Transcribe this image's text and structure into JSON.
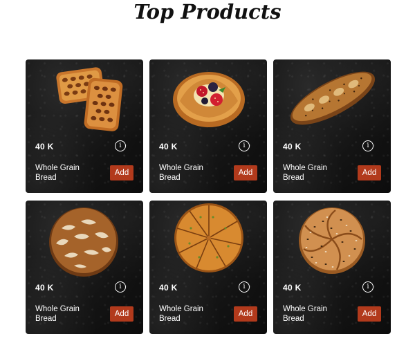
{
  "page": {
    "title": "Top Products"
  },
  "products": [
    {
      "image_icon": "pastry-icon",
      "price": "40 K",
      "info_label": "i",
      "name": "Whole Grain Bread",
      "add_label": "Add"
    },
    {
      "image_icon": "berry-danish-icon",
      "price": "40 K",
      "info_label": "i",
      "name": "Whole Grain Bread",
      "add_label": "Add"
    },
    {
      "image_icon": "baguette-icon",
      "price": "40 K",
      "info_label": "i",
      "name": "Whole Grain Bread",
      "add_label": "Add"
    },
    {
      "image_icon": "sourdough-loaf-icon",
      "price": "40 K",
      "info_label": "i",
      "name": "Whole Grain Bread",
      "add_label": "Add"
    },
    {
      "image_icon": "pie-icon",
      "price": "40 K",
      "info_label": "i",
      "name": "Whole Grain Bread",
      "add_label": "Add"
    },
    {
      "image_icon": "seeded-roll-icon",
      "price": "40 K",
      "info_label": "i",
      "name": "Whole Grain Bread",
      "add_label": "Add"
    }
  ],
  "colors": {
    "accent": "#b23a1c",
    "card_background": "#141414",
    "text_on_card": "#ffffff",
    "title": "#111111"
  }
}
